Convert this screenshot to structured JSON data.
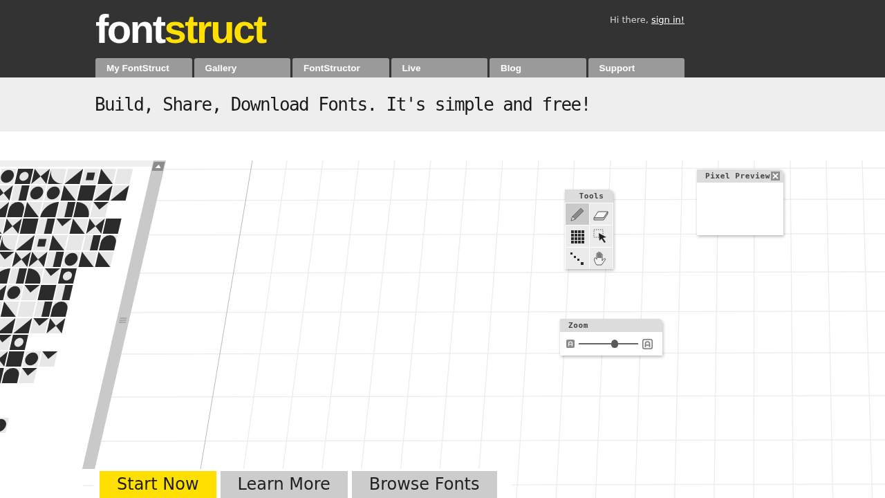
{
  "header": {
    "logo": [
      {
        "text": "font",
        "color": "#ffffff"
      },
      {
        "text": "struct",
        "color": "#ffe000"
      }
    ],
    "greeting": "Hi there,",
    "sign_in": "sign in!"
  },
  "nav": [
    {
      "label": "My FontStruct",
      "selected": false
    },
    {
      "label": "Gallery",
      "selected": false
    },
    {
      "label": "FontStructor",
      "selected": false
    },
    {
      "label": "Live",
      "selected": false
    },
    {
      "label": "Blog",
      "selected": false
    },
    {
      "label": "Support",
      "selected": false
    }
  ],
  "tagline": "Build, Share, Download Fonts. It's simple and free!",
  "editor": {
    "tools_panel": {
      "title": "Tools",
      "tools": [
        {
          "kind": "pencil",
          "selected": true
        },
        {
          "kind": "eraser",
          "selected": false
        },
        {
          "kind": "grid",
          "selected": false
        },
        {
          "kind": "select",
          "selected": false
        },
        {
          "kind": "line",
          "selected": false
        },
        {
          "kind": "hand",
          "selected": false
        }
      ]
    },
    "preview_panel": {
      "title": "Pixel Preview"
    },
    "zoom_panel": {
      "title": "Zoom",
      "level": 0.61
    }
  },
  "actions": [
    {
      "label": "Start Now",
      "kind": "primary"
    },
    {
      "label": "Learn More",
      "kind": "secondary"
    },
    {
      "label": "Browse Fonts",
      "kind": "secondary"
    }
  ]
}
